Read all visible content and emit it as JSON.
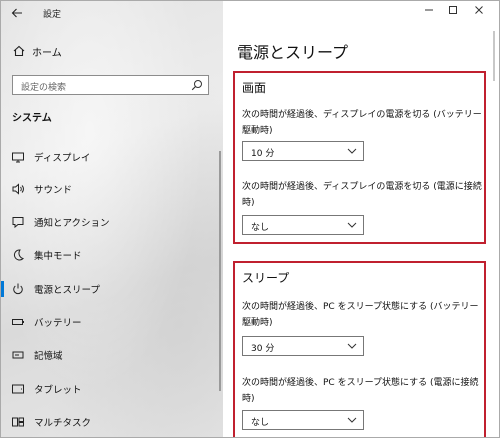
{
  "window": {
    "app_title": "設定"
  },
  "sidebar": {
    "home_label": "ホーム",
    "search_placeholder": "設定の検索",
    "section_title": "システム",
    "items": [
      {
        "label": "ディスプレイ",
        "icon": "monitor-icon"
      },
      {
        "label": "サウンド",
        "icon": "speaker-icon"
      },
      {
        "label": "通知とアクション",
        "icon": "notification-icon"
      },
      {
        "label": "集中モード",
        "icon": "moon-icon"
      },
      {
        "label": "電源とスリープ",
        "icon": "power-icon",
        "active": true
      },
      {
        "label": "バッテリー",
        "icon": "battery-icon"
      },
      {
        "label": "記憶域",
        "icon": "storage-icon"
      },
      {
        "label": "タブレット",
        "icon": "tablet-icon"
      },
      {
        "label": "マルチタスク",
        "icon": "multitask-icon"
      }
    ]
  },
  "main": {
    "title": "電源とスリープ",
    "screen": {
      "heading": "画面",
      "battery_desc": "次の時間が経過後、ディスプレイの電源を切る (バッテリー駆動時)",
      "battery_value": "10 分",
      "plugged_desc": "次の時間が経過後、ディスプレイの電源を切る (電源に接続時)",
      "plugged_value": "なし"
    },
    "sleep": {
      "heading": "スリープ",
      "battery_desc": "次の時間が経過後、PC をスリープ状態にする (バッテリー駆動時)",
      "battery_value": "30 分",
      "plugged_desc": "次の時間が経過後、PC をスリープ状態にする (電源に接続時)",
      "plugged_value": "なし"
    }
  },
  "colors": {
    "accent": "#0078d7",
    "highlight_border": "#c0202f"
  }
}
